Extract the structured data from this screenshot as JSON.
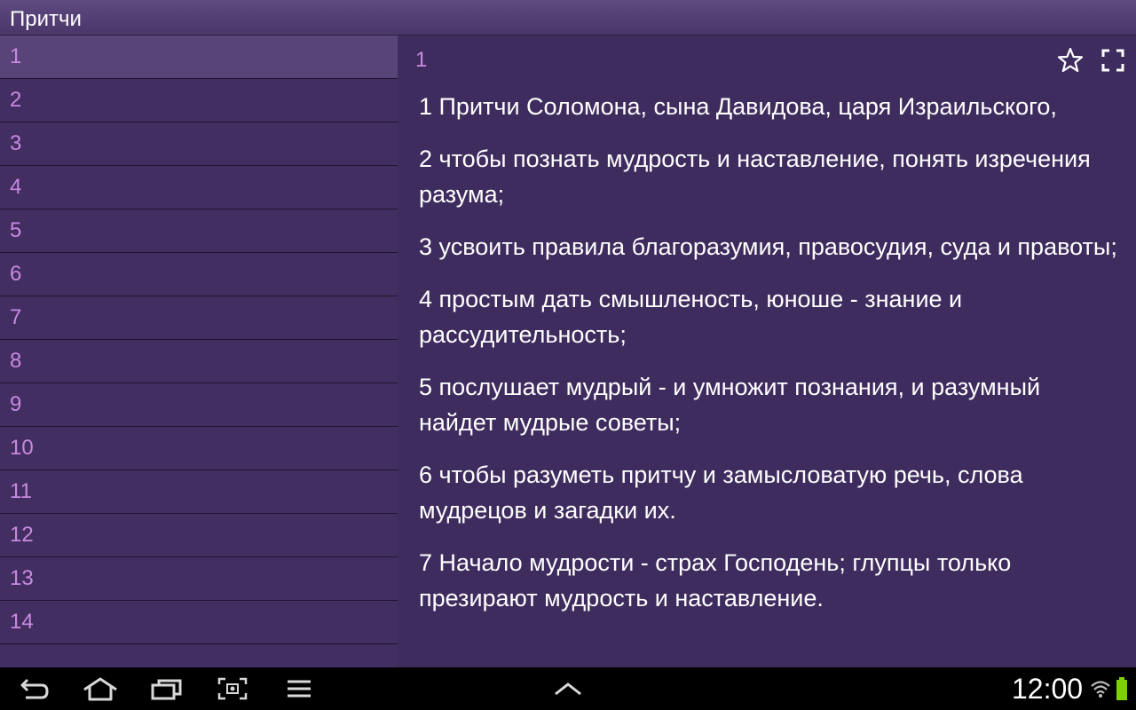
{
  "app": {
    "title": "Притчи"
  },
  "sidebar": {
    "chapters": [
      "1",
      "2",
      "3",
      "4",
      "5",
      "6",
      "7",
      "8",
      "9",
      "10",
      "11",
      "12",
      "13",
      "14"
    ],
    "selected": "1"
  },
  "content": {
    "chapter_number": "1",
    "actions": [
      "star-icon",
      "fullscreen-icon"
    ],
    "verses": [
      "1 Притчи Соломона, сына Давидова, царя Израильского,",
      "2 чтобы познать мудрость и наставление, понять изречения разума;",
      "3 усвоить правила благоразумия, правосудия, суда и правоты;",
      "4 простым дать смышленость, юноше - знание и рассудительность;",
      "5 послушает мудрый - и умножит познания, и разумный найдет мудрые советы;",
      "6 чтобы разуметь притчу и замысловатую речь, слова мудрецов и загадки их.",
      "7 Начало мудрости - страх Господень; глупцы только презирают мудрость и наставление."
    ]
  },
  "system_bar": {
    "clock": "12:00",
    "icons": [
      "back-icon",
      "home-icon",
      "recent-apps-icon",
      "screenshot-icon",
      "menu-icon",
      "up-arrow-icon",
      "wifi-icon",
      "battery-icon"
    ]
  },
  "colors": {
    "background": "#3f2c5e",
    "selected_row": "#584479",
    "chapter_number": "#c88ae0",
    "battery": "#7fd000"
  }
}
